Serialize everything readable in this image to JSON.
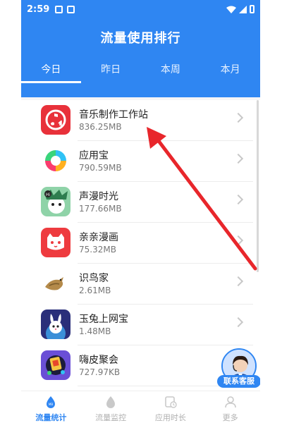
{
  "status_bar": {
    "time": "2:59"
  },
  "header": {
    "title": "流量使用排行"
  },
  "tabs": [
    {
      "label": "今日",
      "active": true
    },
    {
      "label": "昨日",
      "active": false
    },
    {
      "label": "本周",
      "active": false
    },
    {
      "label": "本月",
      "active": false
    }
  ],
  "apps": [
    {
      "name": "音乐制作工作站",
      "usage": "836.25MB",
      "icon": "music-studio-icon"
    },
    {
      "name": "应用宝",
      "usage": "790.59MB",
      "icon": "app-store-icon"
    },
    {
      "name": "声漫时光",
      "usage": "177.66MB",
      "icon": "voice-comic-icon"
    },
    {
      "name": "亲亲漫画",
      "usage": "75.32MB",
      "icon": "comic-cat-icon"
    },
    {
      "name": "识鸟家",
      "usage": "2.61MB",
      "icon": "bird-icon"
    },
    {
      "name": "玉兔上网宝",
      "usage": "1.48MB",
      "icon": "rabbit-icon"
    },
    {
      "name": "嗨皮聚会",
      "usage": "727.97KB",
      "icon": "party-icon"
    }
  ],
  "support": {
    "label": "联系客服"
  },
  "bottom_nav": [
    {
      "label": "流量统计",
      "icon": "traffic-stats-icon",
      "active": true
    },
    {
      "label": "流量监控",
      "icon": "traffic-monitor-icon",
      "active": false
    },
    {
      "label": "应用时长",
      "icon": "app-time-icon",
      "active": false
    },
    {
      "label": "更多",
      "icon": "more-icon",
      "active": false
    }
  ],
  "colors": {
    "primary": "#2f86f2",
    "annotation_arrow": "#e8262b"
  }
}
